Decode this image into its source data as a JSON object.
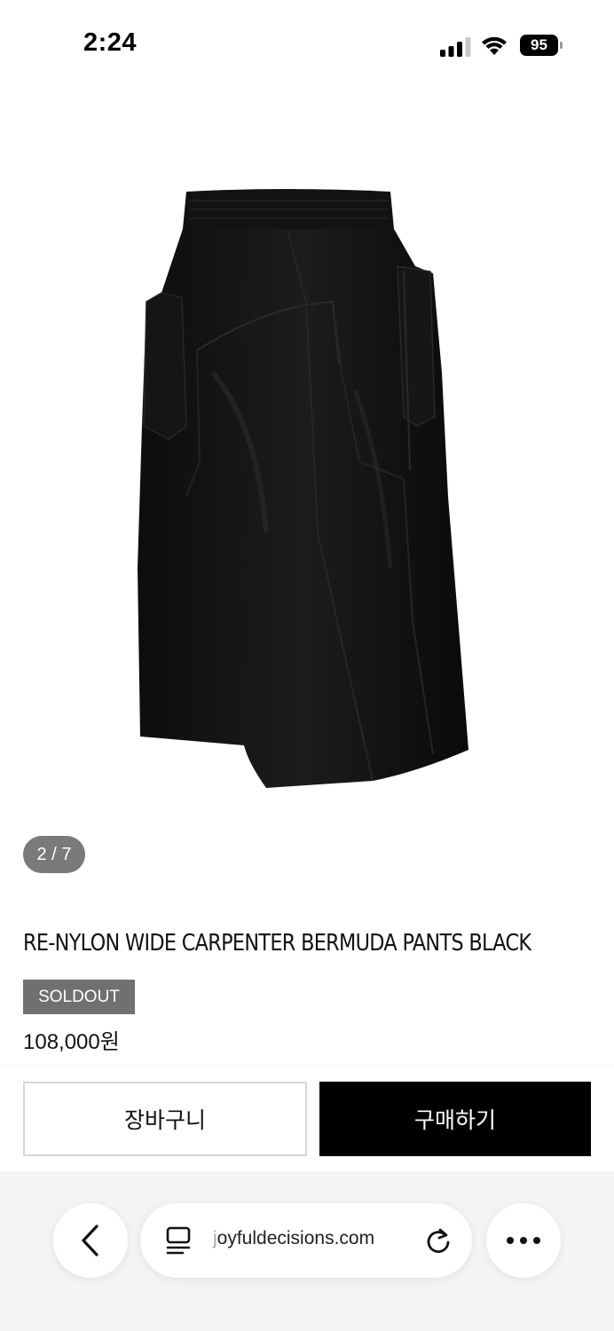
{
  "status_bar": {
    "time": "2:24",
    "battery": "95",
    "icons": [
      "cellular-signal-icon",
      "wifi-icon",
      "battery-icon"
    ]
  },
  "gallery": {
    "counter": "2 / 7",
    "image_alt": "black nylon bermuda shorts product photo"
  },
  "product": {
    "title": "RE-NYLON WIDE CARPENTER BERMUDA PANTS BLACK",
    "badge": "SOLDOUT",
    "price": "108,000원"
  },
  "actions": {
    "cart_label": "장바구니",
    "buy_label": "구매하기"
  },
  "browser": {
    "url_prefix": "j",
    "url": "oyfuldecisions.com",
    "icons": [
      "back-arrow-icon",
      "tab-overview-icon",
      "reload-icon",
      "more-options-icon"
    ]
  },
  "colors": {
    "buy_button": "#000000",
    "soldout_badge": "#707070",
    "counter_pill": "#7a7a7a"
  }
}
